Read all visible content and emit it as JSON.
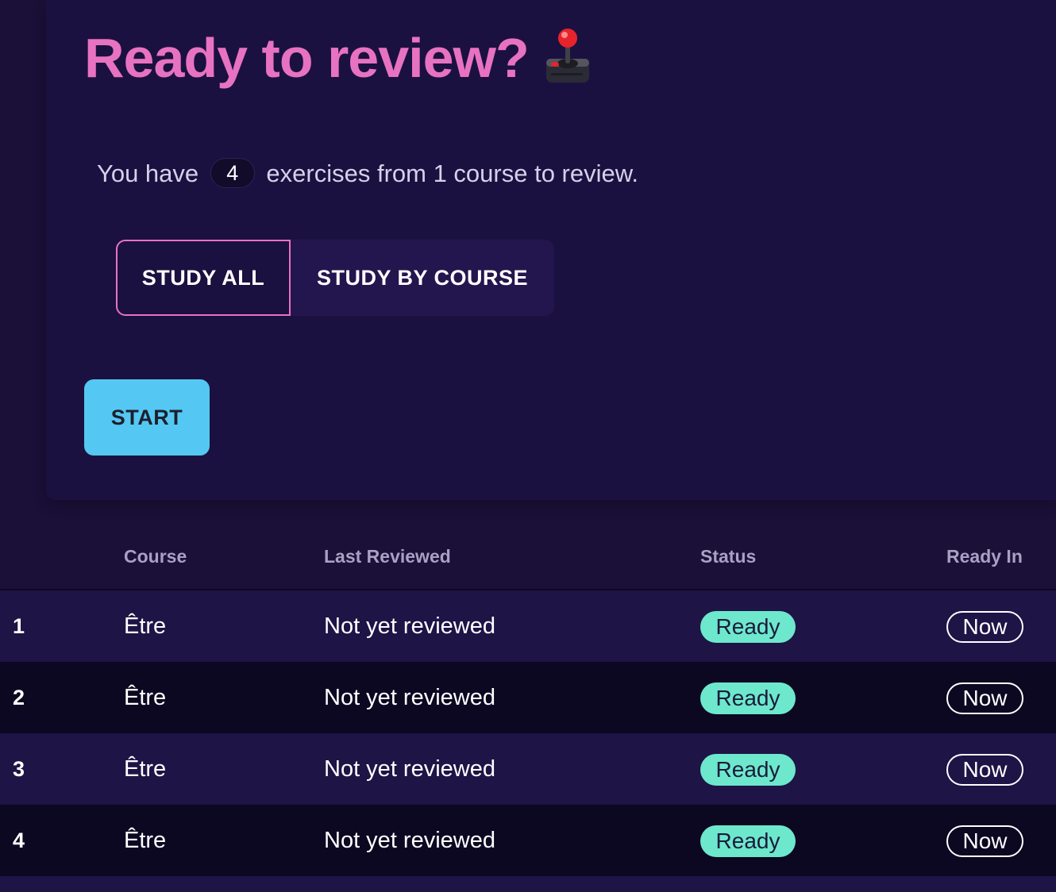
{
  "hero": {
    "title": "Ready to review?",
    "title_icon": "joystick-icon",
    "summary_prefix": "You have",
    "exercise_count": "4",
    "summary_suffix": "exercises from 1 course to review."
  },
  "study_toggle": {
    "options": [
      {
        "label": "STUDY ALL",
        "active": true
      },
      {
        "label": "STUDY BY COURSE",
        "active": false
      }
    ]
  },
  "start_button": {
    "label": "START"
  },
  "colors": {
    "background": "#1a1038",
    "title": "#e872c2",
    "start_button": "#54c8f2",
    "ready_badge": "#6de8cd"
  },
  "table": {
    "headers": {
      "course": "Course",
      "last_reviewed": "Last Reviewed",
      "status": "Status",
      "ready_in": "Ready In"
    },
    "rows": [
      {
        "index": "1",
        "course": "Être",
        "last_reviewed": "Not yet reviewed",
        "status": "Ready",
        "ready_in": "Now"
      },
      {
        "index": "2",
        "course": "Être",
        "last_reviewed": "Not yet reviewed",
        "status": "Ready",
        "ready_in": "Now"
      },
      {
        "index": "3",
        "course": "Être",
        "last_reviewed": "Not yet reviewed",
        "status": "Ready",
        "ready_in": "Now"
      },
      {
        "index": "4",
        "course": "Être",
        "last_reviewed": "Not yet reviewed",
        "status": "Ready",
        "ready_in": "Now"
      }
    ]
  }
}
